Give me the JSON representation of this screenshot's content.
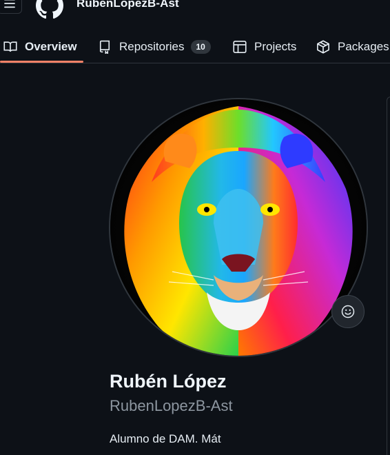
{
  "header": {
    "username": "RubenLopezB-Ast",
    "menu_icon": "hamburger-icon",
    "logo_icon": "github-logo-icon"
  },
  "tabs": [
    {
      "label": "Overview",
      "icon": "book-icon",
      "active": true
    },
    {
      "label": "Repositories",
      "icon": "repo-icon",
      "count": "10"
    },
    {
      "label": "Projects",
      "icon": "table-icon"
    },
    {
      "label": "Packages",
      "icon": "package-icon"
    }
  ],
  "profile": {
    "full_name": "Rubén López",
    "login": "RubenLopezB-Ast",
    "bio_partial": "Alumno de DAM. Mát",
    "status_icon": "smiley-icon",
    "avatar_icon": "rainbow-lion-avatar"
  },
  "colors": {
    "background": "#0d1117",
    "border": "#30363d",
    "active_tab_underline": "#f78166",
    "text": "#e6edf3",
    "muted": "#8d96a0"
  }
}
